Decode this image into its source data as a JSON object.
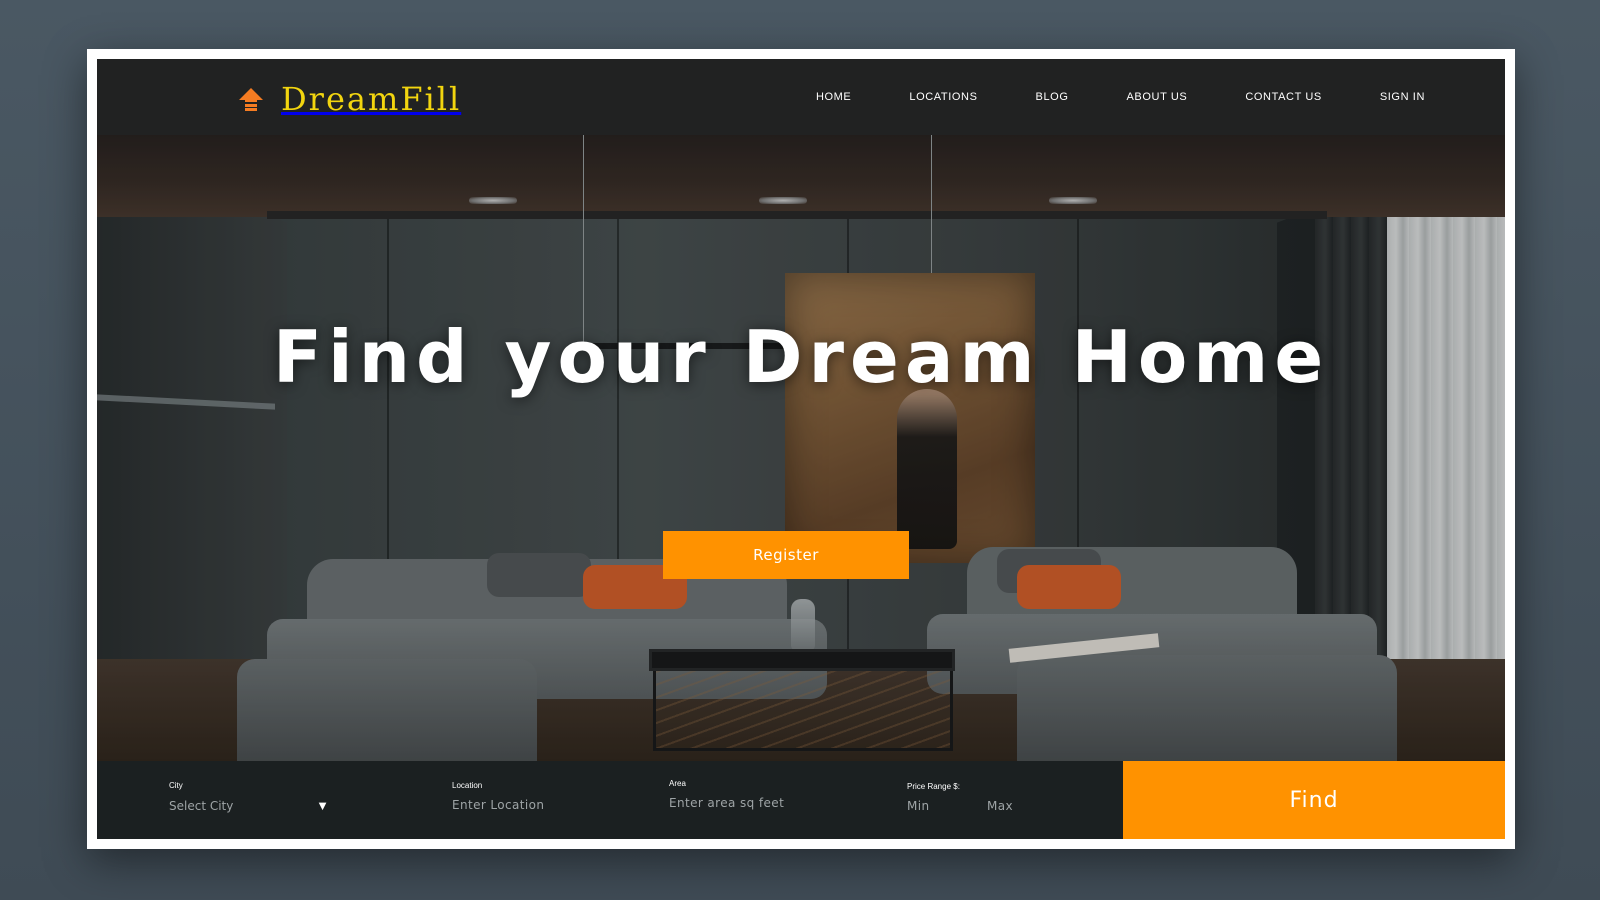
{
  "brand": {
    "name": "DreamFill",
    "logo_icon": "home-arrow-icon",
    "logo_color": "#f2d50f",
    "icon_color": "#f57c22"
  },
  "nav": {
    "items": [
      "HOME",
      "LOCATIONS",
      "BLOG",
      "ABOUT US",
      "CONTACT US",
      "SIGN IN"
    ]
  },
  "hero": {
    "title": "Find your Dream Home",
    "register_label": "Register",
    "background": "living-room-photo"
  },
  "search": {
    "city": {
      "label": "City",
      "value": "Select City",
      "icon": "caret-down-icon"
    },
    "location": {
      "label": "Location",
      "placeholder": "Enter Location"
    },
    "area": {
      "label": "Area",
      "placeholder": "Enter area sq feet"
    },
    "price": {
      "label": "Price Range $:",
      "min_placeholder": "Min",
      "max_placeholder": "Max"
    },
    "find_label": "Find"
  },
  "colors": {
    "accent": "#ff9200",
    "search_bar_bg": "#1b2021",
    "page_bg": "#4a5863"
  }
}
